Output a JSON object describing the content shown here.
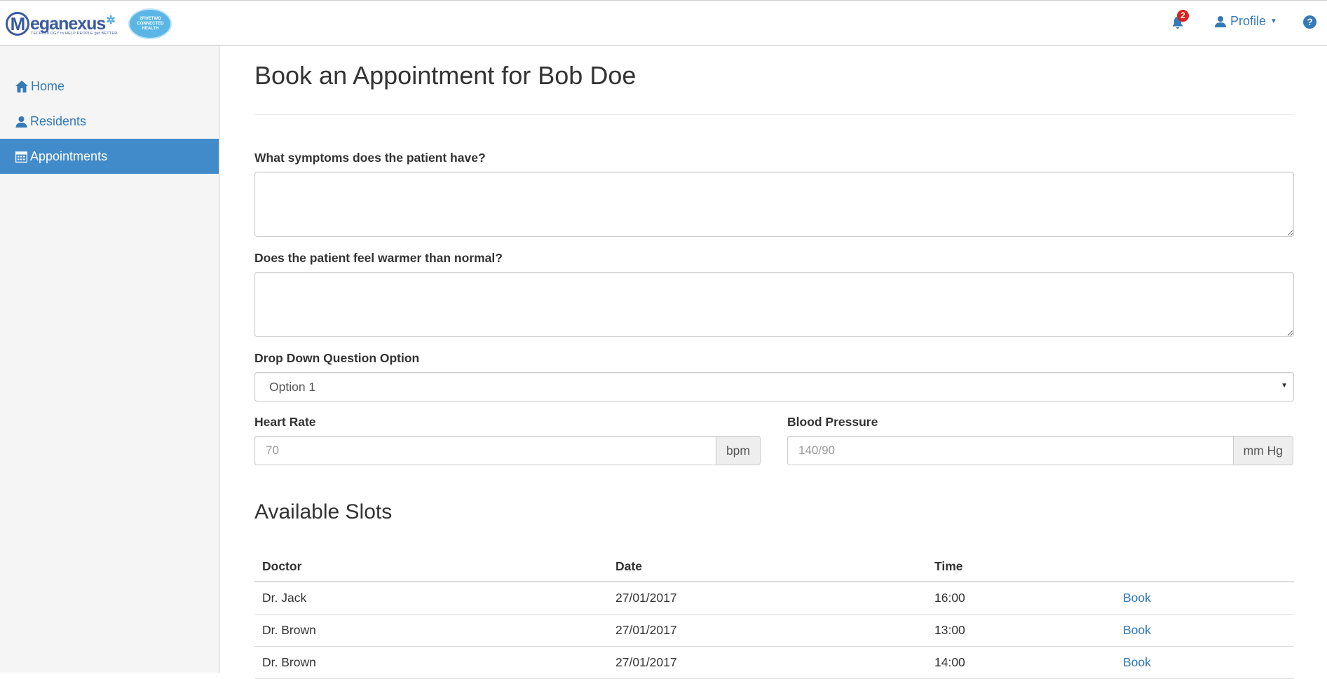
{
  "header": {
    "logo_text": "eganexus",
    "logo_tagline": "TECHNOLOGY to HELP PEOPLE get BETTER",
    "partner_logo_text": "2FIVETWO CONNECTED HEALTH",
    "notifications_count": "2",
    "profile_label": "Profile",
    "help_label": "?"
  },
  "sidebar": {
    "items": [
      {
        "label": "Home",
        "icon": "home-icon",
        "active": false
      },
      {
        "label": "Residents",
        "icon": "user-icon",
        "active": false
      },
      {
        "label": "Appointments",
        "icon": "calendar-icon",
        "active": true
      }
    ]
  },
  "page": {
    "title": "Book an Appointment for Bob Doe",
    "symptoms_label": "What symptoms does the patient have?",
    "symptoms_value": "",
    "warmer_label": "Does the patient feel warmer than normal?",
    "warmer_value": "",
    "dropdown_label": "Drop Down Question Option",
    "dropdown_value": "Option 1",
    "heart_rate_label": "Heart Rate",
    "heart_rate_placeholder": "70",
    "heart_rate_unit": "bpm",
    "blood_pressure_label": "Blood Pressure",
    "blood_pressure_placeholder": "140/90",
    "blood_pressure_unit": "mm Hg",
    "slots_title": "Available Slots"
  },
  "slots_table": {
    "headers": [
      "Doctor",
      "Date",
      "Time",
      ""
    ],
    "rows": [
      {
        "doctor": "Dr. Jack",
        "date": "27/01/2017",
        "time": "16:00",
        "action": "Book"
      },
      {
        "doctor": "Dr. Brown",
        "date": "27/01/2017",
        "time": "13:00",
        "action": "Book"
      },
      {
        "doctor": "Dr. Brown",
        "date": "27/01/2017",
        "time": "14:00",
        "action": "Book"
      }
    ]
  },
  "colors": {
    "accent": "#337ab7",
    "active_nav": "#428bca",
    "badge": "#d9211b"
  }
}
